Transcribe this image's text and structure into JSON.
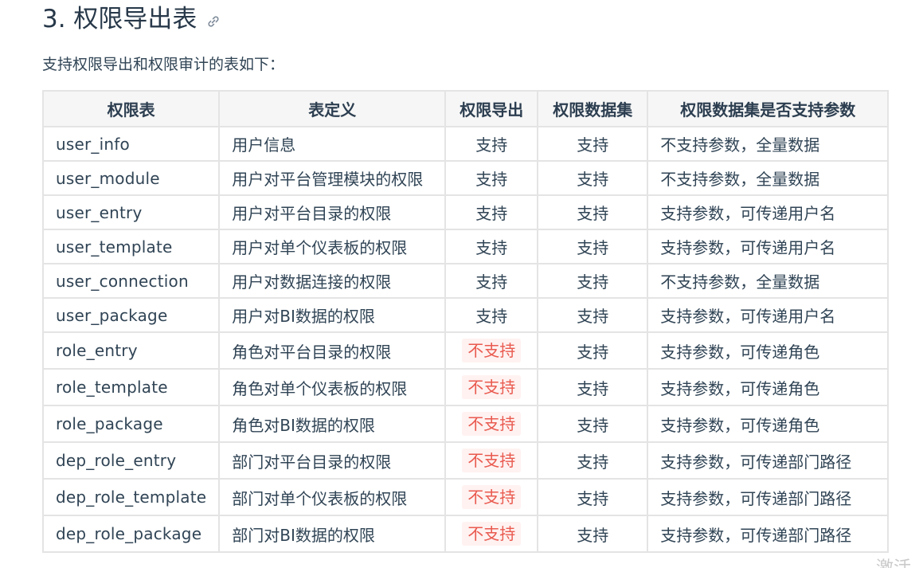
{
  "heading": {
    "title": "3. 权限导出表",
    "link_icon": "link-icon"
  },
  "intro": "支持权限导出和权限审计的表如下：",
  "table": {
    "headers": [
      "权限表",
      "表定义",
      "权限导出",
      "权限数据集",
      "权限数据集是否支持参数"
    ],
    "rows": [
      {
        "name": "user_info",
        "definition": "用户信息",
        "export": "支持",
        "export_supported": true,
        "dataset": "支持",
        "params": "不支持参数，全量数据"
      },
      {
        "name": "user_module",
        "definition": "用户对平台管理模块的权限",
        "export": "支持",
        "export_supported": true,
        "dataset": "支持",
        "params": "不支持参数，全量数据"
      },
      {
        "name": "user_entry",
        "definition": "用户对平台目录的权限",
        "export": "支持",
        "export_supported": true,
        "dataset": "支持",
        "params": "支持参数，可传递用户名"
      },
      {
        "name": "user_template",
        "definition": "用户对单个仪表板的权限",
        "export": "支持",
        "export_supported": true,
        "dataset": "支持",
        "params": "支持参数，可传递用户名"
      },
      {
        "name": "user_connection",
        "definition": "用户对数据连接的权限",
        "export": "支持",
        "export_supported": true,
        "dataset": "支持",
        "params": "不支持参数，全量数据"
      },
      {
        "name": "user_package",
        "definition": "用户对BI数据的权限",
        "export": "支持",
        "export_supported": true,
        "dataset": "支持",
        "params": "支持参数，可传递用户名"
      },
      {
        "name": "role_entry",
        "definition": "角色对平台目录的权限",
        "export": "不支持",
        "export_supported": false,
        "dataset": "支持",
        "params": "支持参数，可传递角色"
      },
      {
        "name": "role_template",
        "definition": "角色对单个仪表板的权限",
        "export": "不支持",
        "export_supported": false,
        "dataset": "支持",
        "params": "支持参数，可传递角色"
      },
      {
        "name": "role_package",
        "definition": "角色对BI数据的权限",
        "export": "不支持",
        "export_supported": false,
        "dataset": "支持",
        "params": "支持参数，可传递角色"
      },
      {
        "name": "dep_role_entry",
        "definition": "部门对平台目录的权限",
        "export": "不支持",
        "export_supported": false,
        "dataset": "支持",
        "params": "支持参数，可传递部门路径"
      },
      {
        "name": "dep_role_template",
        "definition": "部门对单个仪表板的权限",
        "export": "不支持",
        "export_supported": false,
        "dataset": "支持",
        "params": "支持参数，可传递部门路径"
      },
      {
        "name": "dep_role_package",
        "definition": "部门对BI数据的权限",
        "export": "不支持",
        "export_supported": false,
        "dataset": "支持",
        "params": "支持参数，可传递部门路径"
      }
    ]
  },
  "watermark": "激活",
  "colors": {
    "unsupported_text": "#e95a4f",
    "unsupported_bg": "#fff2f1",
    "header_bg": "#f6f6f6"
  }
}
